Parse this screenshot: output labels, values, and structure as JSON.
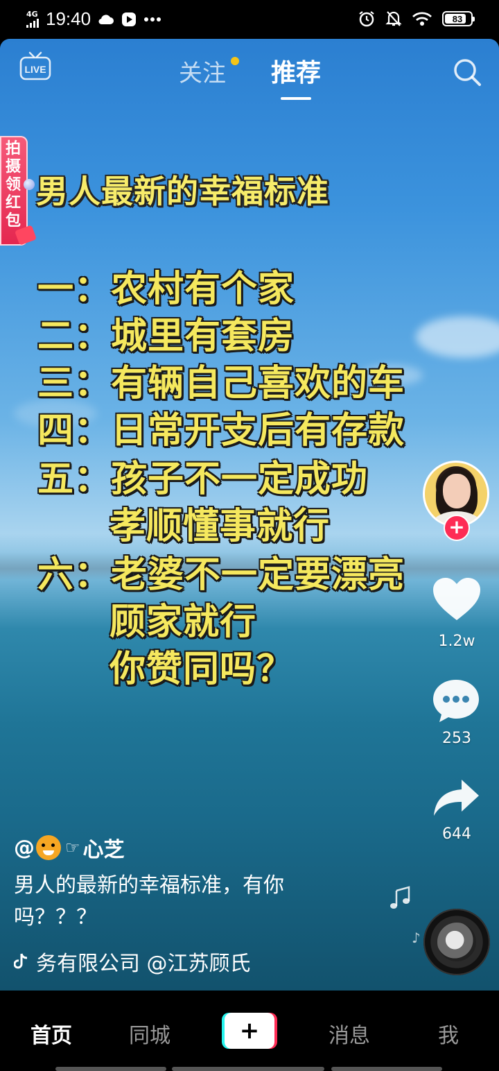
{
  "status_bar": {
    "network": "4G",
    "time": "19:40",
    "battery": "83",
    "battery_level": 0.83
  },
  "top_nav": {
    "live_icon": "live-tv-icon",
    "live_label": "LIVE",
    "tab_follow": "关注",
    "tab_recommend": "推荐",
    "search_icon": "search-icon"
  },
  "red_packet": {
    "label": "拍摄领红包"
  },
  "video_overlay": {
    "title": "男人最新的幸福标准",
    "lines": [
      "一：农村有个家",
      "二：城里有套房",
      "三：有辆自己喜欢的车",
      "四：日常开支后有存款",
      "五：孩子不一定成功",
      "孝顺懂事就行",
      "六：老婆不一定要漂亮",
      "顾家就行",
      "你赞同吗？"
    ]
  },
  "right_rail": {
    "follow_plus": "+",
    "like_count": "1.2w",
    "comment_count": "253",
    "share_count": "644"
  },
  "bottom_info": {
    "author_prefix": "@",
    "author_name": "心芝",
    "description": "男人的最新的幸福标准，有你吗？？？",
    "music_text": "务有限公司    @江苏顾氏"
  },
  "bottom_nav": {
    "home": "首页",
    "city": "同城",
    "add": "+",
    "messages": "消息",
    "me": "我"
  },
  "colors": {
    "accent_red": "#fe2c55",
    "accent_cyan": "#25f4ee",
    "overlay_text": "#f5e85e",
    "follow_dot": "#f5c518"
  }
}
